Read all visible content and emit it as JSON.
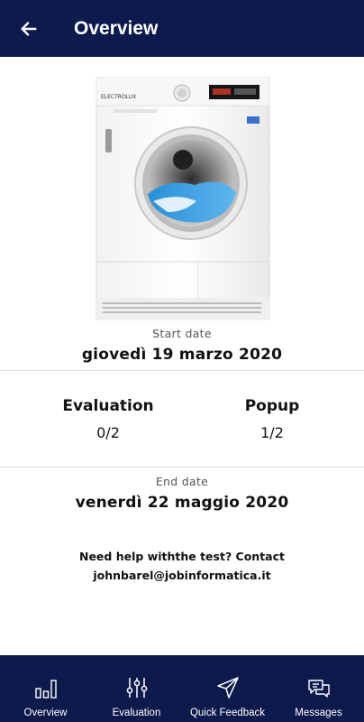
{
  "header": {
    "title": "Overview",
    "back_icon": "arrow-left-icon"
  },
  "product": {
    "image": "washing-machine-image",
    "brand_text": "ELECTROLUX"
  },
  "start": {
    "label": "Start date",
    "value": "giovedì 19 marzo 2020"
  },
  "stats": {
    "evaluation": {
      "label": "Evaluation",
      "value": "0/2"
    },
    "popup": {
      "label": "Popup",
      "value": "1/2"
    }
  },
  "end": {
    "label": "End date",
    "value": "venerdì 22 maggio 2020"
  },
  "help": {
    "line1": "Need help withthe test? Contact",
    "line2": "johnbarel@jobinformatica.it"
  },
  "tabs": [
    {
      "label": "Overview",
      "icon": "bar-chart-icon"
    },
    {
      "label": "Evaluation",
      "icon": "sliders-icon"
    },
    {
      "label": "Quick Feedback",
      "icon": "send-icon"
    },
    {
      "label": "Messages",
      "icon": "chat-bubbles-icon"
    }
  ],
  "colors": {
    "navy": "#0e1a4c",
    "white": "#ffffff",
    "divider": "#dcdcdc"
  }
}
